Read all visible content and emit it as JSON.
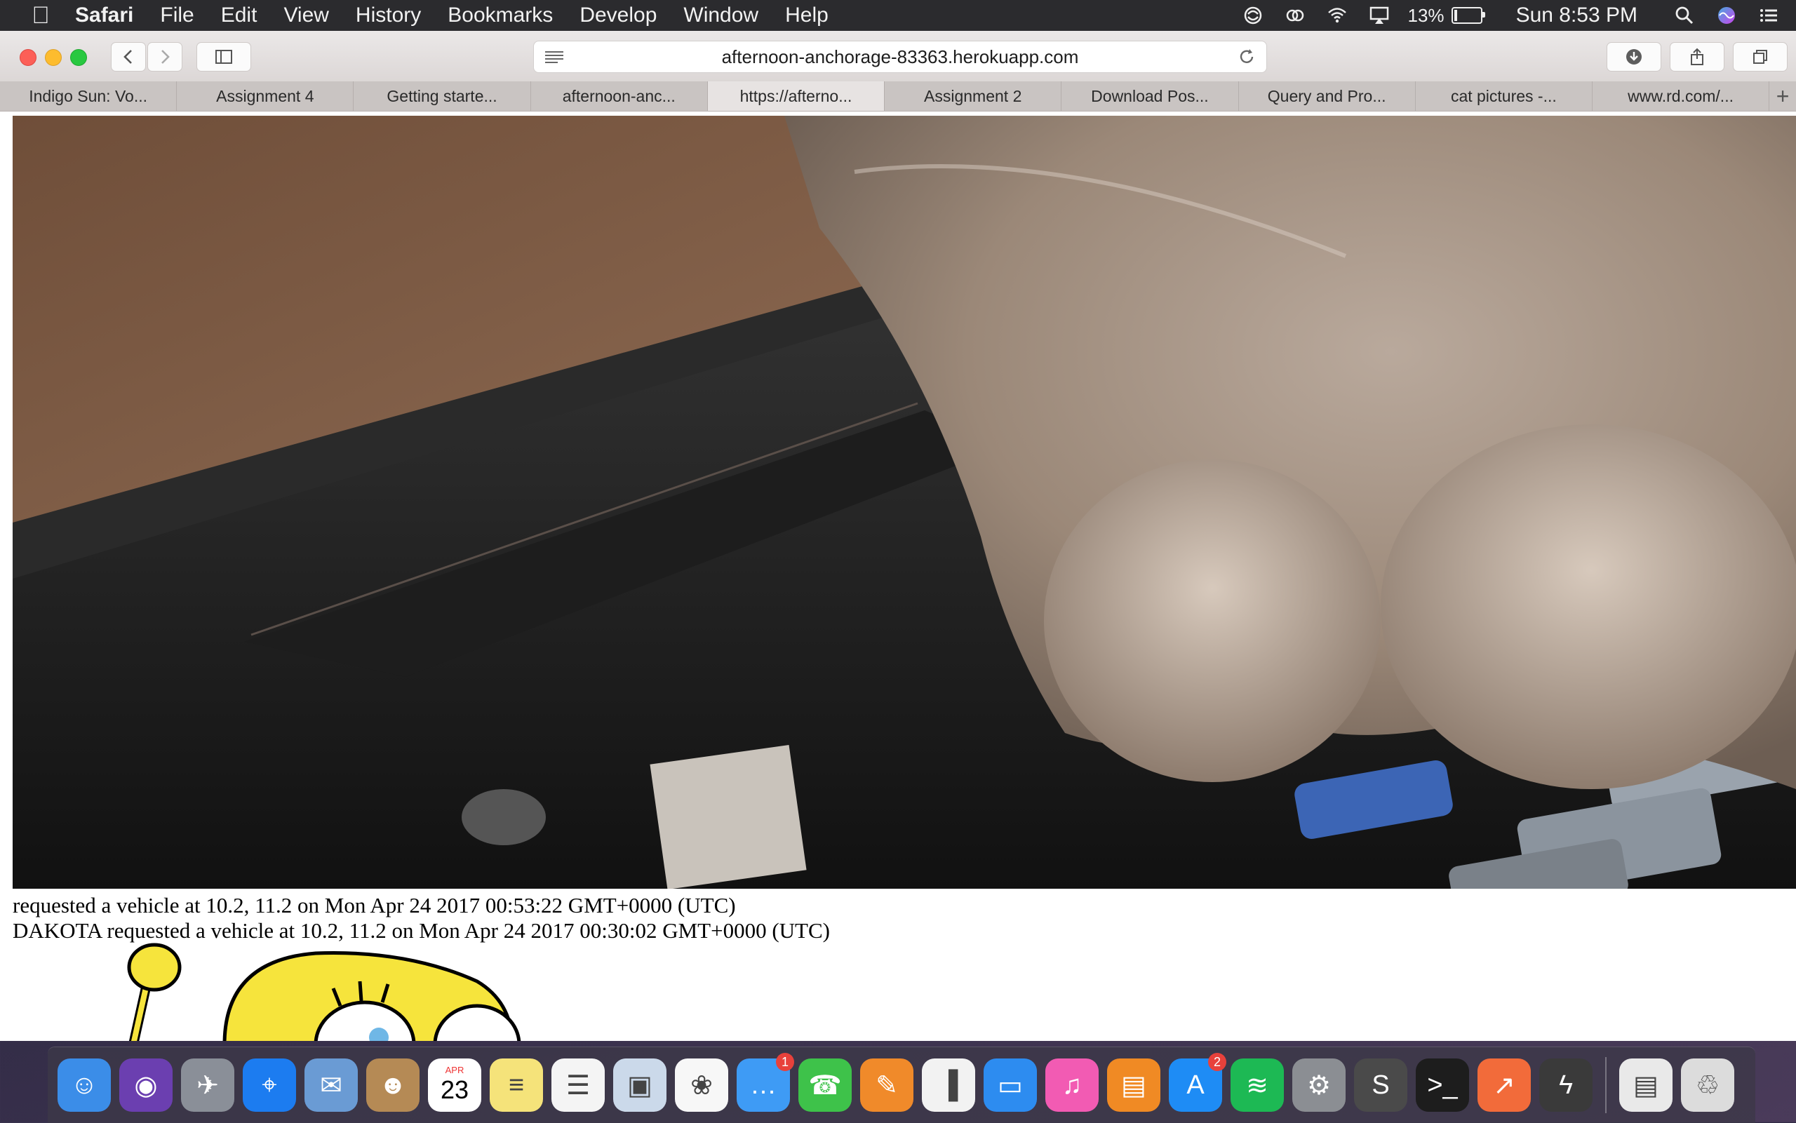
{
  "menubar": {
    "app_name": "Safari",
    "items": [
      "File",
      "Edit",
      "View",
      "History",
      "Bookmarks",
      "Develop",
      "Window",
      "Help"
    ],
    "battery_percent": "13%",
    "battery_level": 0.13,
    "clock": "Sun 8:53 PM"
  },
  "browser": {
    "url": "afternoon-anchorage-83363.herokuapp.com",
    "tabs": [
      {
        "label": "Indigo Sun: Vo..."
      },
      {
        "label": "Assignment 4"
      },
      {
        "label": "Getting starte..."
      },
      {
        "label": "afternoon-anc..."
      },
      {
        "label": "https://afterno..."
      },
      {
        "label": "Assignment 2"
      },
      {
        "label": "Download Pos..."
      },
      {
        "label": "Query and Pro..."
      },
      {
        "label": "cat pictures -..."
      },
      {
        "label": "www.rd.com/..."
      }
    ],
    "active_tab_index": 4
  },
  "page": {
    "log_lines": [
      "requested a vehicle at 10.2, 11.2 on Mon Apr 24 2017 00:53:22 GMT+0000 (UTC)",
      "DAKOTA requested a vehicle at 10.2, 11.2 on Mon Apr 24 2017 00:30:02 GMT+0000 (UTC)"
    ]
  },
  "dock": {
    "calendar_month": "APR",
    "calendar_day": "23",
    "messages_badge": "1",
    "appstore_badge": "2",
    "apps": [
      {
        "name": "Finder",
        "icon": "finder-icon",
        "color": "#3b8de8"
      },
      {
        "name": "Siri",
        "icon": "siri-icon",
        "color": "#6b3fb0"
      },
      {
        "name": "Launchpad",
        "icon": "rocket-icon",
        "color": "#8a8f98"
      },
      {
        "name": "Safari",
        "icon": "compass-icon",
        "color": "#1c7cf0"
      },
      {
        "name": "Mail",
        "icon": "stamp-icon",
        "color": "#6a9bd4"
      },
      {
        "name": "Contacts",
        "icon": "contacts-icon",
        "color": "#b58a55"
      },
      {
        "name": "Calendar",
        "icon": "calendar-icon",
        "color": "#ffffff"
      },
      {
        "name": "Notes",
        "icon": "notes-icon",
        "color": "#f5e37a"
      },
      {
        "name": "Reminders",
        "icon": "list-icon",
        "color": "#f4f4f4"
      },
      {
        "name": "Preview",
        "icon": "preview-icon",
        "color": "#cbd9ea"
      },
      {
        "name": "Photos",
        "icon": "photos-icon",
        "color": "#f7f7f7"
      },
      {
        "name": "Messages",
        "icon": "chat-icon",
        "color": "#3e9bf5"
      },
      {
        "name": "FaceTime",
        "icon": "camera-icon",
        "color": "#3ec24a"
      },
      {
        "name": "Pages",
        "icon": "pencil-icon",
        "color": "#f08a2a"
      },
      {
        "name": "Numbers",
        "icon": "barchart-icon",
        "color": "#f2f2f2"
      },
      {
        "name": "Keynote",
        "icon": "podium-icon",
        "color": "#2d8cf0"
      },
      {
        "name": "iTunes",
        "icon": "music-icon",
        "color": "#f25bb3"
      },
      {
        "name": "iBooks",
        "icon": "book-icon",
        "color": "#f08a24"
      },
      {
        "name": "App Store",
        "icon": "appstore-icon",
        "color": "#1e8cf5"
      },
      {
        "name": "Spotify",
        "icon": "spotify-icon",
        "color": "#1db954"
      },
      {
        "name": "System Preferences",
        "icon": "gear-icon",
        "color": "#8b8e93"
      },
      {
        "name": "Sublime Text",
        "icon": "sublime-icon",
        "color": "#4a4a4a"
      },
      {
        "name": "Terminal",
        "icon": "terminal-icon",
        "color": "#1d1d1d"
      },
      {
        "name": "Postman",
        "icon": "postman-icon",
        "color": "#f26b3a"
      },
      {
        "name": "Lightning",
        "icon": "bolt-icon",
        "color": "#3a3a3a"
      },
      {
        "name": "Downloads stack",
        "icon": "documents-icon",
        "color": "#e9e9e9"
      },
      {
        "name": "Trash",
        "icon": "trash-icon",
        "color": "#dcdcdc"
      }
    ]
  }
}
